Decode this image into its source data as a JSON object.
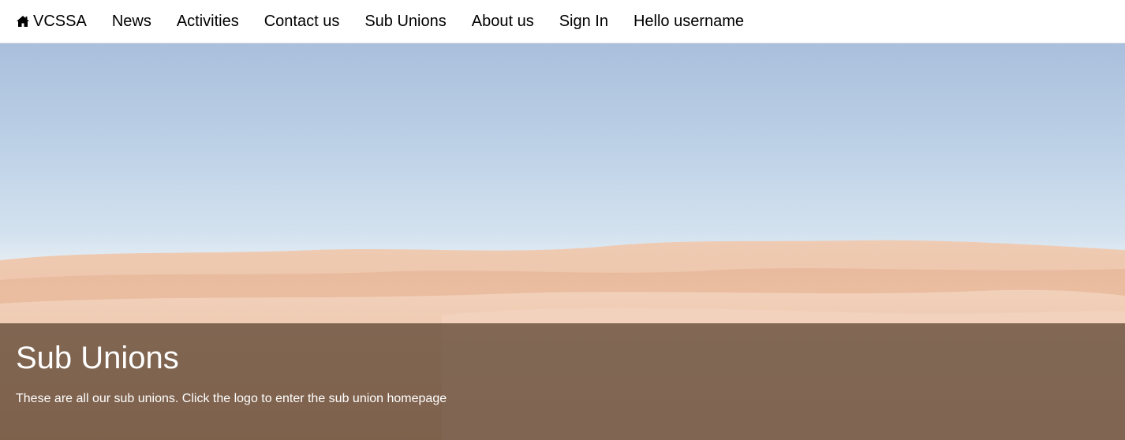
{
  "navbar": {
    "brand": {
      "icon": "home-icon",
      "label": "VCSSA"
    },
    "items": [
      {
        "label": "News"
      },
      {
        "label": "Activities"
      },
      {
        "label": "Contact us"
      },
      {
        "label": "Sub Unions"
      },
      {
        "label": "About us"
      },
      {
        "label": "Sign In"
      },
      {
        "label": "Hello username"
      }
    ]
  },
  "hero": {
    "title": "Sub Unions",
    "subtitle": "These are all our sub unions. Click the logo to enter the sub union homepage"
  },
  "colors": {
    "navbar_background": "#ffffff",
    "nav_text": "#000000",
    "caption_overlay": "#553e2d",
    "caption_text": "#ffffff"
  }
}
